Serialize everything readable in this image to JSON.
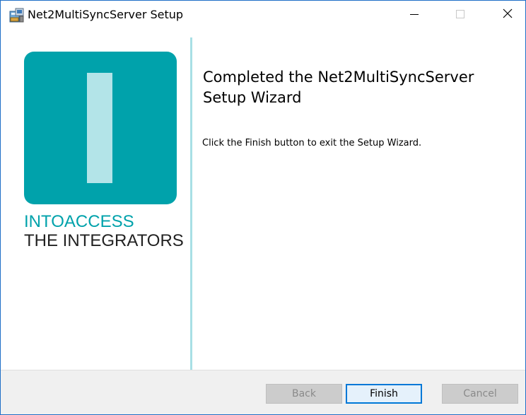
{
  "window": {
    "title": "Net2MultiSyncServer Setup",
    "icon": "installer-icon"
  },
  "titlebar_controls": {
    "minimize": "minimize-icon",
    "maximize": "maximize-icon",
    "close": "close-icon"
  },
  "banner": {
    "brand_line1": "INTOACCESS",
    "brand_line2": "THE INTEGRATORS",
    "logo_color": "#00a2ab",
    "logo_bar_color": "#b3e4e8",
    "divider_color": "#a8dfe5"
  },
  "main": {
    "title": "Completed the Net2MultiSyncServer Setup Wizard",
    "body": "Click the Finish button to exit the Setup Wizard."
  },
  "footer": {
    "back_label": "Back",
    "finish_label": "Finish",
    "cancel_label": "Cancel",
    "accent_color": "#0078d7"
  }
}
